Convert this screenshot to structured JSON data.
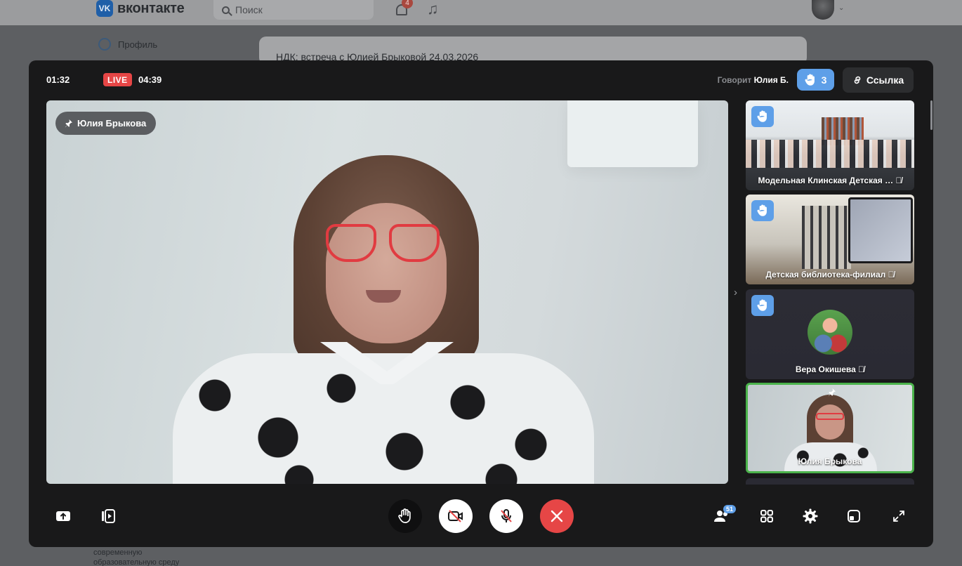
{
  "vk": {
    "brand": "вконтакте",
    "logo_letters": "VK",
    "search_placeholder": "Поиск",
    "notifications_count": "4",
    "profile_label": "Профиль",
    "post_title": "НДК: встреча с Юлией Брыковой 24.03.2026",
    "footer_text_1": "современную",
    "footer_text_2": "образовательную среду"
  },
  "call": {
    "elapsed": "01:32",
    "live_label": "LIVE",
    "live_duration": "04:39",
    "speaking_prefix": "Говорит",
    "speaking_name": "Юлия Б.",
    "raised_hands": "3",
    "link_label": "Ссылка",
    "pinned_name": "Юлия Брыкова",
    "participants_count": "51"
  },
  "tiles": [
    {
      "name": "Модельная Клинская Детская …",
      "hand_raised": true,
      "mic_off": true
    },
    {
      "name": "Детская библиотека-филиал",
      "hand_raised": true,
      "mic_off": true
    },
    {
      "name": "Вера Окишева",
      "hand_raised": true,
      "mic_off": true
    },
    {
      "name": "Юлия Брыкова",
      "hand_raised": false,
      "pinned": true,
      "active": true
    }
  ],
  "colors": {
    "accent": "#5e9fe8",
    "live": "#e64646",
    "end_call": "#e64646",
    "active_speaker": "#4bb34b",
    "panel": "#19191a"
  },
  "icons": {
    "share_screen": "share-screen-icon",
    "media": "media-play-icon",
    "raise_hand": "raise-hand-icon",
    "camera_off": "camera-off-icon",
    "mic_off": "mic-off-icon",
    "end_call": "close-icon",
    "participants": "participants-icon",
    "grid": "grid-icon",
    "settings": "gear-icon",
    "layout": "layout-icon",
    "fullscreen": "fullscreen-icon"
  }
}
